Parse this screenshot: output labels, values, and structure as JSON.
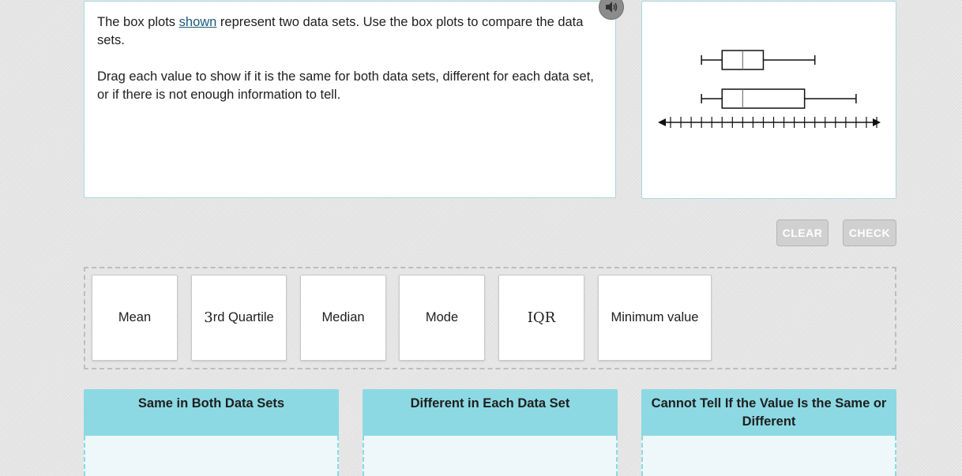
{
  "question": {
    "line1_before": "The box plots ",
    "line1_link": "shown",
    "line1_after": " represent two data sets. Use the box plots to compare the data sets.",
    "instruction": "Drag each value to show if it is the same for both data sets, different for each data set, or if there is not enough information to tell."
  },
  "icons": {
    "audio": "speaker-icon"
  },
  "figure": {
    "type": "box plots on a number line with unlabeled ticks",
    "plots": [
      {
        "min": 3,
        "q1": 5,
        "median": 7,
        "q3": 9,
        "max": 14
      },
      {
        "min": 3,
        "q1": 5,
        "median": 7,
        "q3": 13,
        "max": 18
      }
    ],
    "axis_ticks": {
      "from": 0,
      "to": 20,
      "step": 1,
      "labels_shown": false
    }
  },
  "buttons": {
    "clear": "CLEAR",
    "check": "CHECK"
  },
  "tiles": {
    "mean": "Mean",
    "third_quartile_num": "3",
    "third_quartile_rest": "rd Quartile",
    "median": "Median",
    "mode": "Mode",
    "iqr": "IQR",
    "minimum": "Minimum value"
  },
  "categories": {
    "same": "Same in Both Data Sets",
    "different": "Different in Each Data Set",
    "cannot_tell": "Cannot Tell If the Value Is the Same or Different"
  },
  "colors": {
    "category_header": "#8cd9e3",
    "panel_border": "#a9d8de",
    "button_disabled": "#d0d0d0"
  }
}
